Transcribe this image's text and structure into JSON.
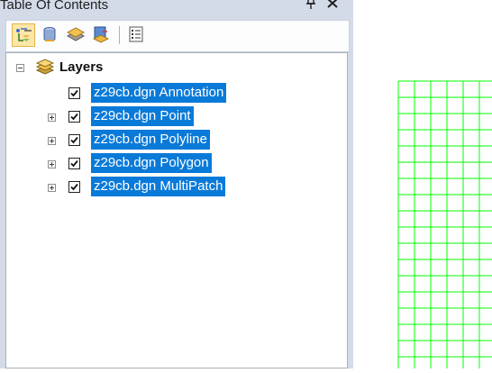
{
  "window": {
    "title": "Table Of Contents",
    "pin_glyph": "⊥",
    "close_glyph": "×"
  },
  "toolbar": {
    "buttons": [
      {
        "name": "list-by-drawing-order",
        "icon": "layers-list-icon",
        "active": true
      },
      {
        "name": "list-by-source",
        "icon": "database-icon",
        "active": false
      },
      {
        "name": "list-by-visibility",
        "icon": "visibility-layers-icon",
        "active": false
      },
      {
        "name": "list-by-selection",
        "icon": "selection-icon",
        "active": false
      },
      {
        "name": "options",
        "icon": "options-list-icon",
        "active": false
      }
    ]
  },
  "tree": {
    "group": {
      "label": "Layers",
      "expanded": true
    },
    "layers": [
      {
        "label": "z29cb.dgn Annotation",
        "checked": true,
        "expandable": false
      },
      {
        "label": "z29cb.dgn Point",
        "checked": true,
        "expandable": true
      },
      {
        "label": "z29cb.dgn Polyline",
        "checked": true,
        "expandable": true
      },
      {
        "label": "z29cb.dgn Polygon",
        "checked": true,
        "expandable": true
      },
      {
        "label": "z29cb.dgn MultiPatch",
        "checked": true,
        "expandable": true
      }
    ]
  },
  "map": {
    "grid_color": "#00ff00",
    "background": "#ffffff"
  },
  "colors": {
    "selection": "#0a7ad9",
    "panel": "#d4dbe8"
  }
}
